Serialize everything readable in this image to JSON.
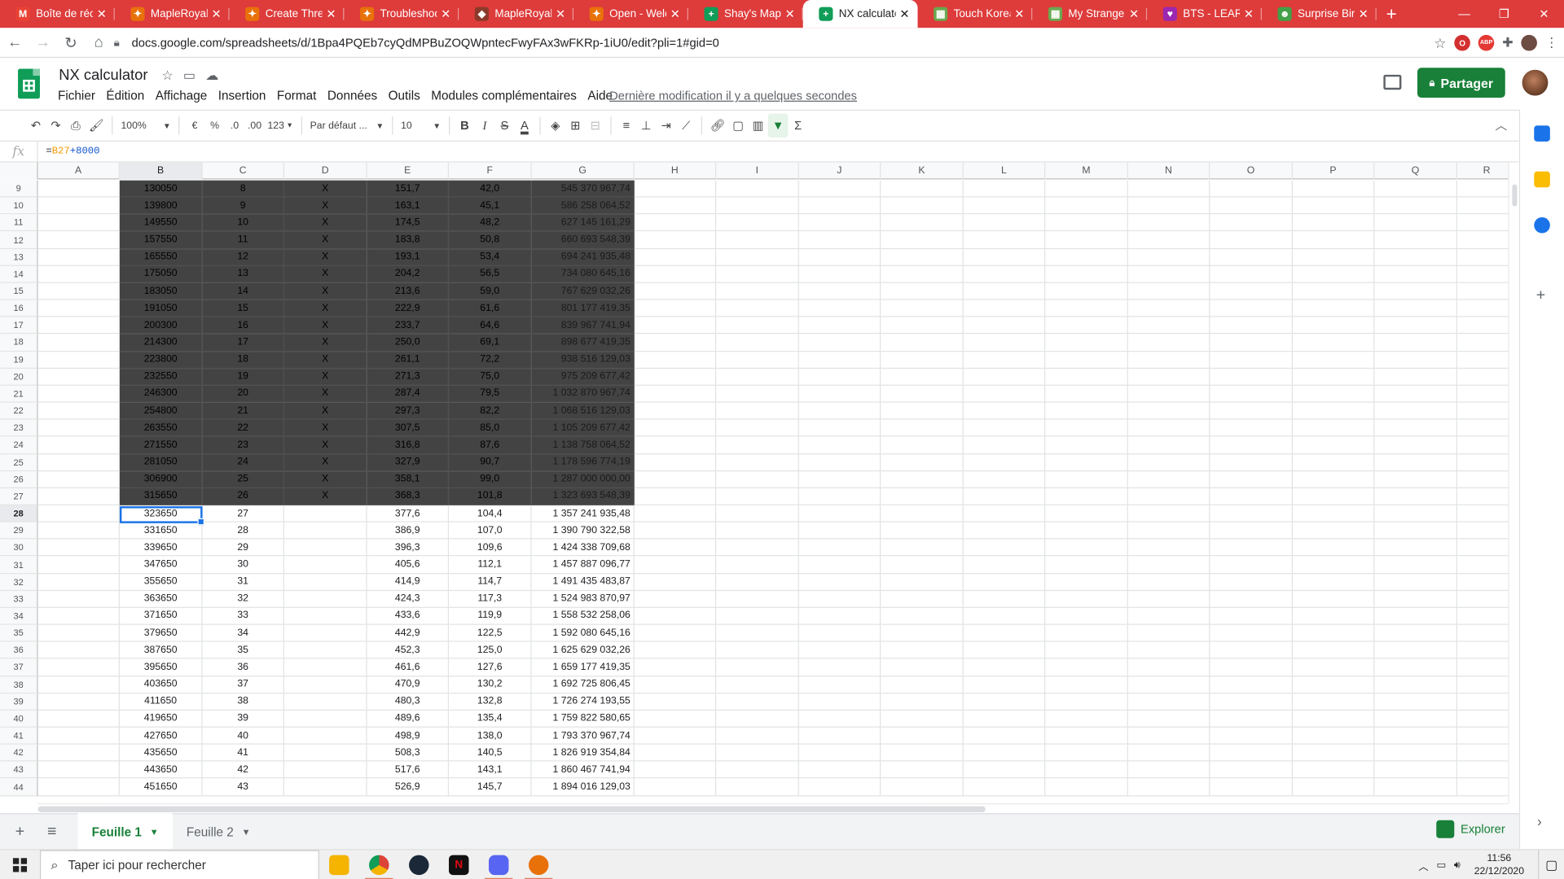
{
  "browser": {
    "tabs": [
      {
        "title": "Boîte de réception",
        "favicon_color": "#ea4335",
        "favicon_glyph": "M"
      },
      {
        "title": "MapleRoyals",
        "favicon_color": "#e8710a",
        "favicon_glyph": "✦"
      },
      {
        "title": "Create Thread",
        "favicon_color": "#e8710a",
        "favicon_glyph": "✦"
      },
      {
        "title": "Troubleshooting",
        "favicon_color": "#e8710a",
        "favicon_glyph": "✦"
      },
      {
        "title": "MapleRoyals",
        "favicon_color": "#8b3a2a",
        "favicon_glyph": "◆"
      },
      {
        "title": "Open - Welcome",
        "favicon_color": "#e8710a",
        "favicon_glyph": "✦"
      },
      {
        "title": "Shay's MapleRoyals",
        "favicon_color": "#0f9d58",
        "favicon_glyph": "+"
      },
      {
        "title": "NX calculator",
        "favicon_color": "#0f9d58",
        "favicon_glyph": "+",
        "active": true
      },
      {
        "title": "Touch Korean",
        "favicon_color": "#6aa84f",
        "favicon_glyph": "▦"
      },
      {
        "title": "My Strange Hobby",
        "favicon_color": "#6aa84f",
        "favicon_glyph": "▦"
      },
      {
        "title": "BTS - LEARN K",
        "favicon_color": "#9c27b0",
        "favicon_glyph": "♥"
      },
      {
        "title": "Surprise Birthday",
        "favicon_color": "#43a047",
        "favicon_glyph": "☻"
      }
    ],
    "url": "docs.google.com/spreadsheets/d/1Bpa4PQEb7cyQdMPBuZOQWpntecFwyFAx3wFKRp-1iU0/edit?pli=1#gid=0"
  },
  "sheets": {
    "title": "NX calculator",
    "menu": [
      "Fichier",
      "Édition",
      "Affichage",
      "Insertion",
      "Format",
      "Données",
      "Outils",
      "Modules complémentaires",
      "Aide"
    ],
    "last_edit": "Dernière modification il y a quelques secondes",
    "share_label": "Partager",
    "toolbar": {
      "zoom": "100%",
      "currency": "€",
      "percent": "%",
      "dec_less": ".0",
      "dec_more": ".00",
      "format_more": "123",
      "font": "Par défaut ...",
      "font_size": "10"
    },
    "formula": {
      "prefix": "=",
      "ref": "B27",
      "rest": "+8000"
    },
    "columns": [
      "A",
      "B",
      "C",
      "D",
      "E",
      "F",
      "G",
      "H",
      "I",
      "J",
      "K",
      "L",
      "M",
      "N",
      "O",
      "P",
      "Q",
      "R"
    ],
    "rows": [
      {
        "n": "9",
        "b": "130050",
        "c": "8",
        "d": "X",
        "e": "151,7",
        "f": "42,0",
        "g": "545 370 967,74"
      },
      {
        "n": "10",
        "b": "139800",
        "c": "9",
        "d": "X",
        "e": "163,1",
        "f": "45,1",
        "g": "586 258 064,52"
      },
      {
        "n": "11",
        "b": "149550",
        "c": "10",
        "d": "X",
        "e": "174,5",
        "f": "48,2",
        "g": "627 145 161,29"
      },
      {
        "n": "12",
        "b": "157550",
        "c": "11",
        "d": "X",
        "e": "183,8",
        "f": "50,8",
        "g": "660 693 548,39"
      },
      {
        "n": "13",
        "b": "165550",
        "c": "12",
        "d": "X",
        "e": "193,1",
        "f": "53,4",
        "g": "694 241 935,48"
      },
      {
        "n": "14",
        "b": "175050",
        "c": "13",
        "d": "X",
        "e": "204,2",
        "f": "56,5",
        "g": "734 080 645,16"
      },
      {
        "n": "15",
        "b": "183050",
        "c": "14",
        "d": "X",
        "e": "213,6",
        "f": "59,0",
        "g": "767 629 032,26"
      },
      {
        "n": "16",
        "b": "191050",
        "c": "15",
        "d": "X",
        "e": "222,9",
        "f": "61,6",
        "g": "801 177 419,35"
      },
      {
        "n": "17",
        "b": "200300",
        "c": "16",
        "d": "X",
        "e": "233,7",
        "f": "64,6",
        "g": "839 967 741,94"
      },
      {
        "n": "18",
        "b": "214300",
        "c": "17",
        "d": "X",
        "e": "250,0",
        "f": "69,1",
        "g": "898 677 419,35"
      },
      {
        "n": "19",
        "b": "223800",
        "c": "18",
        "d": "X",
        "e": "261,1",
        "f": "72,2",
        "g": "938 516 129,03"
      },
      {
        "n": "20",
        "b": "232550",
        "c": "19",
        "d": "X",
        "e": "271,3",
        "f": "75,0",
        "g": "975 209 677,42"
      },
      {
        "n": "21",
        "b": "246300",
        "c": "20",
        "d": "X",
        "e": "287,4",
        "f": "79,5",
        "g": "1 032 870 967,74"
      },
      {
        "n": "22",
        "b": "254800",
        "c": "21",
        "d": "X",
        "e": "297,3",
        "f": "82,2",
        "g": "1 068 516 129,03"
      },
      {
        "n": "23",
        "b": "263550",
        "c": "22",
        "d": "X",
        "e": "307,5",
        "f": "85,0",
        "g": "1 105 209 677,42"
      },
      {
        "n": "24",
        "b": "271550",
        "c": "23",
        "d": "X",
        "e": "316,8",
        "f": "87,6",
        "g": "1 138 758 064,52"
      },
      {
        "n": "25",
        "b": "281050",
        "c": "24",
        "d": "X",
        "e": "327,9",
        "f": "90,7",
        "g": "1 178 596 774,19"
      },
      {
        "n": "26",
        "b": "306900",
        "c": "25",
        "d": "X",
        "e": "358,1",
        "f": "99,0",
        "g": "1 287 000 000,00"
      },
      {
        "n": "27",
        "b": "315650",
        "c": "26",
        "d": "X",
        "e": "368,3",
        "f": "101,8",
        "g": "1 323 693 548,39"
      },
      {
        "n": "28",
        "b": "323650",
        "c": "27",
        "d": "",
        "e": "377,6",
        "f": "104,4",
        "g": "1 357 241 935,48"
      },
      {
        "n": "29",
        "b": "331650",
        "c": "28",
        "d": "",
        "e": "386,9",
        "f": "107,0",
        "g": "1 390 790 322,58"
      },
      {
        "n": "30",
        "b": "339650",
        "c": "29",
        "d": "",
        "e": "396,3",
        "f": "109,6",
        "g": "1 424 338 709,68"
      },
      {
        "n": "31",
        "b": "347650",
        "c": "30",
        "d": "",
        "e": "405,6",
        "f": "112,1",
        "g": "1 457 887 096,77"
      },
      {
        "n": "32",
        "b": "355650",
        "c": "31",
        "d": "",
        "e": "414,9",
        "f": "114,7",
        "g": "1 491 435 483,87"
      },
      {
        "n": "33",
        "b": "363650",
        "c": "32",
        "d": "",
        "e": "424,3",
        "f": "117,3",
        "g": "1 524 983 870,97"
      },
      {
        "n": "34",
        "b": "371650",
        "c": "33",
        "d": "",
        "e": "433,6",
        "f": "119,9",
        "g": "1 558 532 258,06"
      },
      {
        "n": "35",
        "b": "379650",
        "c": "34",
        "d": "",
        "e": "442,9",
        "f": "122,5",
        "g": "1 592 080 645,16"
      },
      {
        "n": "36",
        "b": "387650",
        "c": "35",
        "d": "",
        "e": "452,3",
        "f": "125,0",
        "g": "1 625 629 032,26"
      },
      {
        "n": "37",
        "b": "395650",
        "c": "36",
        "d": "",
        "e": "461,6",
        "f": "127,6",
        "g": "1 659 177 419,35"
      },
      {
        "n": "38",
        "b": "403650",
        "c": "37",
        "d": "",
        "e": "470,9",
        "f": "130,2",
        "g": "1 692 725 806,45"
      },
      {
        "n": "39",
        "b": "411650",
        "c": "38",
        "d": "",
        "e": "480,3",
        "f": "132,8",
        "g": "1 726 274 193,55"
      },
      {
        "n": "40",
        "b": "419650",
        "c": "39",
        "d": "",
        "e": "489,6",
        "f": "135,4",
        "g": "1 759 822 580,65"
      },
      {
        "n": "41",
        "b": "427650",
        "c": "40",
        "d": "",
        "e": "498,9",
        "f": "138,0",
        "g": "1 793 370 967,74"
      },
      {
        "n": "42",
        "b": "435650",
        "c": "41",
        "d": "",
        "e": "508,3",
        "f": "140,5",
        "g": "1 826 919 354,84"
      },
      {
        "n": "43",
        "b": "443650",
        "c": "42",
        "d": "",
        "e": "517,6",
        "f": "143,1",
        "g": "1 860 467 741,94"
      },
      {
        "n": "44",
        "b": "451650",
        "c": "43",
        "d": "",
        "e": "526,9",
        "f": "145,7",
        "g": "1 894 016 129,03"
      }
    ],
    "dark_rows_until": 27,
    "selected_row": "28",
    "sheet_tabs": [
      "Feuille 1",
      "Feuille 2"
    ],
    "explore_label": "Explorer"
  },
  "taskbar": {
    "search_placeholder": "Taper ici pour rechercher",
    "time": "11:56",
    "date": "22/12/2020"
  },
  "colors": {
    "accent": "#188038",
    "chrome_tab": "#de3b3b",
    "dark_fill": "#434343",
    "selection": "#1a73e8"
  }
}
